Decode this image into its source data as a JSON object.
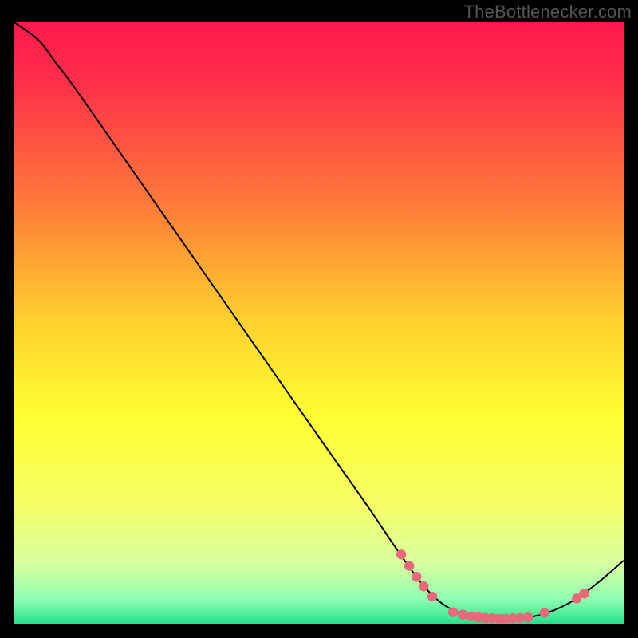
{
  "watermark": "TheBottlenecker.com",
  "chart_data": {
    "type": "line",
    "title": "",
    "xlabel": "",
    "ylabel": "",
    "xlim": [
      0,
      100
    ],
    "ylim": [
      0,
      100
    ],
    "gradient_stops": [
      {
        "offset": 0,
        "color": "#ff1a4d"
      },
      {
        "offset": 0.1,
        "color": "#ff2f4a"
      },
      {
        "offset": 0.3,
        "color": "#ff7a3a"
      },
      {
        "offset": 0.5,
        "color": "#ffd22e"
      },
      {
        "offset": 0.66,
        "color": "#ffff33"
      },
      {
        "offset": 0.8,
        "color": "#f6ff66"
      },
      {
        "offset": 0.9,
        "color": "#d8ffa0"
      },
      {
        "offset": 0.96,
        "color": "#8dffb3"
      },
      {
        "offset": 1.0,
        "color": "#27e08a"
      }
    ],
    "curve": [
      {
        "x": 0,
        "y": 100
      },
      {
        "x": 4,
        "y": 97
      },
      {
        "x": 7,
        "y": 93
      },
      {
        "x": 10,
        "y": 89
      },
      {
        "x": 20,
        "y": 74.5
      },
      {
        "x": 30,
        "y": 60
      },
      {
        "x": 40,
        "y": 45.5
      },
      {
        "x": 50,
        "y": 31
      },
      {
        "x": 58,
        "y": 19.5
      },
      {
        "x": 63,
        "y": 12
      },
      {
        "x": 67,
        "y": 6.5
      },
      {
        "x": 70,
        "y": 3.5
      },
      {
        "x": 73,
        "y": 1.8
      },
      {
        "x": 76,
        "y": 1.0
      },
      {
        "x": 80,
        "y": 0.8
      },
      {
        "x": 84,
        "y": 1.0
      },
      {
        "x": 88,
        "y": 2.0
      },
      {
        "x": 92,
        "y": 4.0
      },
      {
        "x": 96,
        "y": 7.0
      },
      {
        "x": 100,
        "y": 10.5
      }
    ],
    "markers": [
      {
        "x": 63.5,
        "y": 11.5
      },
      {
        "x": 64.8,
        "y": 9.6
      },
      {
        "x": 66.0,
        "y": 7.8
      },
      {
        "x": 67.2,
        "y": 6.2
      },
      {
        "x": 68.6,
        "y": 4.5
      },
      {
        "x": 72.0,
        "y": 1.9
      },
      {
        "x": 73.6,
        "y": 1.5
      },
      {
        "x": 75.0,
        "y": 1.2
      },
      {
        "x": 76.2,
        "y": 1.05
      },
      {
        "x": 77.3,
        "y": 0.95
      },
      {
        "x": 78.4,
        "y": 0.88
      },
      {
        "x": 79.5,
        "y": 0.82
      },
      {
        "x": 80.6,
        "y": 0.82
      },
      {
        "x": 81.8,
        "y": 0.88
      },
      {
        "x": 83.0,
        "y": 0.95
      },
      {
        "x": 84.3,
        "y": 1.05
      },
      {
        "x": 87.0,
        "y": 1.8
      },
      {
        "x": 92.3,
        "y": 4.2
      },
      {
        "x": 93.5,
        "y": 5.0
      }
    ],
    "marker_color": "#e86a7a",
    "curve_color": "#000000"
  }
}
